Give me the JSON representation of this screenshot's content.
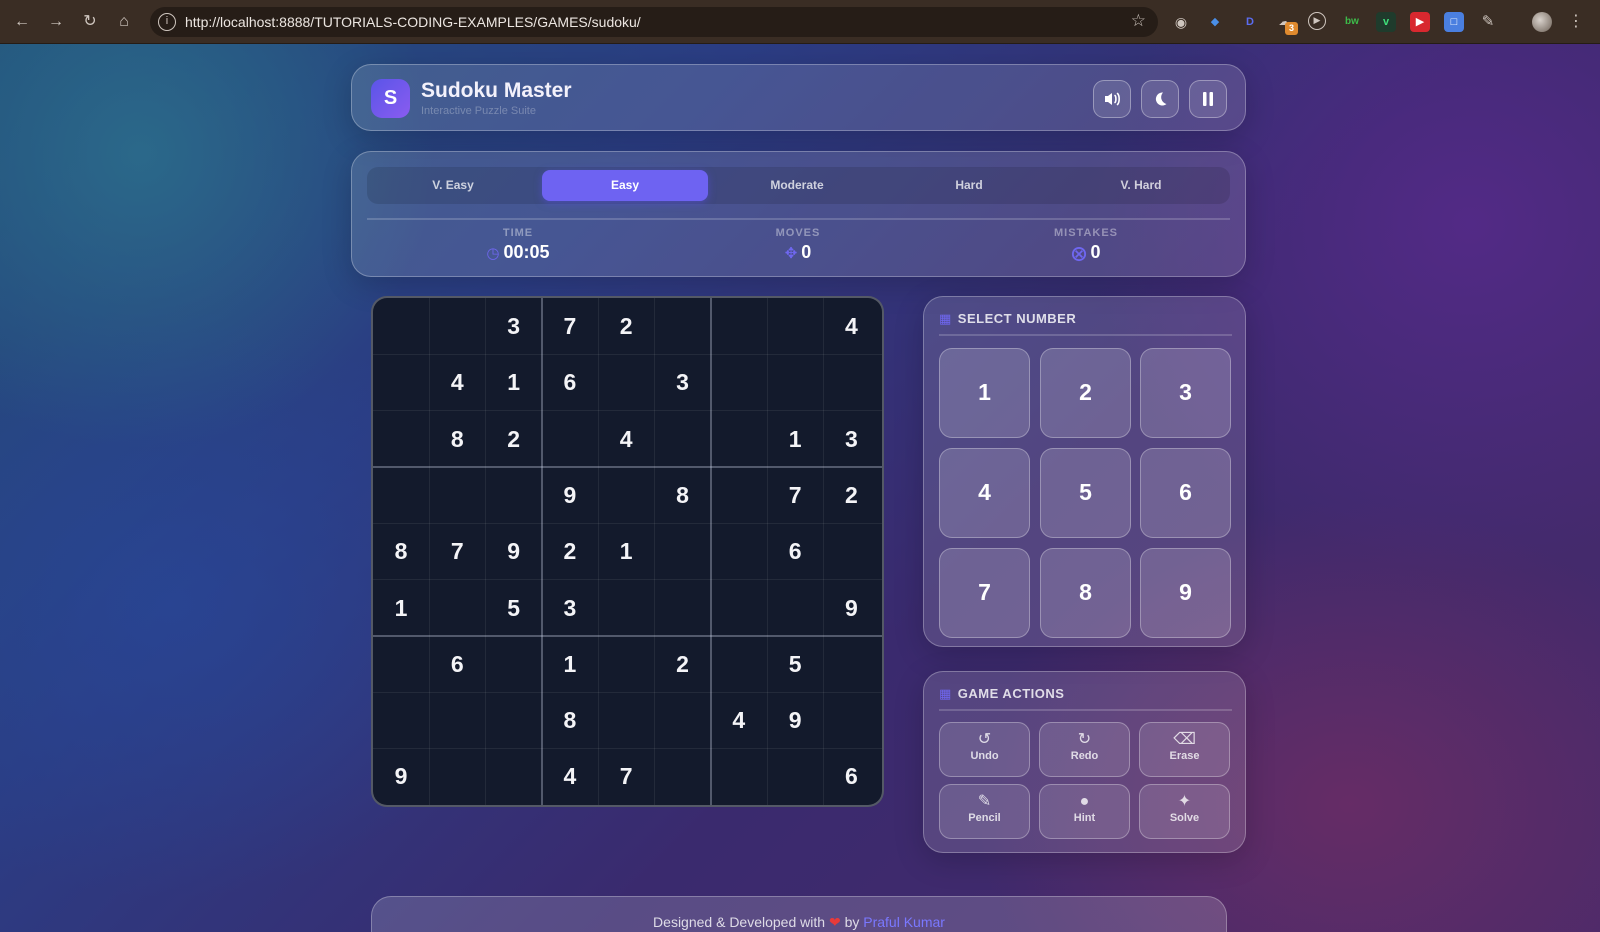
{
  "browser": {
    "url": "http://localhost:8888/TUTORIALS-CODING-EXAMPLES/GAMES/sudoku/",
    "extension_badge": "3"
  },
  "header": {
    "logo_letter": "S",
    "title": "Sudoku Master",
    "subtitle": "Interactive Puzzle Suite"
  },
  "difficulty": {
    "options": [
      "V. Easy",
      "Easy",
      "Moderate",
      "Hard",
      "V. Hard"
    ],
    "selected": "Easy"
  },
  "stats": {
    "time_label": "TIME",
    "time_value": "00:05",
    "moves_label": "MOVES",
    "moves_value": "0",
    "mistakes_label": "MISTAKES",
    "mistakes_value": "0"
  },
  "board": {
    "rows": [
      [
        "",
        "",
        "3",
        "7",
        "2",
        "",
        "",
        "",
        "4"
      ],
      [
        "",
        "4",
        "1",
        "6",
        "",
        "3",
        "",
        "",
        ""
      ],
      [
        "",
        "8",
        "2",
        "",
        "4",
        "",
        "",
        "1",
        "3"
      ],
      [
        "",
        "",
        "",
        "9",
        "",
        "8",
        "",
        "7",
        "2"
      ],
      [
        "8",
        "7",
        "9",
        "2",
        "1",
        "",
        "",
        "6",
        ""
      ],
      [
        "1",
        "",
        "5",
        "3",
        "",
        "",
        "",
        "",
        "9"
      ],
      [
        "",
        "6",
        "",
        "1",
        "",
        "2",
        "",
        "5",
        ""
      ],
      [
        "",
        "",
        "",
        "8",
        "",
        "",
        "4",
        "9",
        ""
      ],
      [
        "9",
        "",
        "",
        "4",
        "7",
        "",
        "",
        "",
        "6"
      ]
    ]
  },
  "number_pad": {
    "title": "SELECT NUMBER",
    "numbers": [
      "1",
      "2",
      "3",
      "4",
      "5",
      "6",
      "7",
      "8",
      "9"
    ]
  },
  "actions": {
    "title": "GAME ACTIONS",
    "buttons": [
      {
        "label": "Undo",
        "icon": "undo-icon"
      },
      {
        "label": "Redo",
        "icon": "redo-icon"
      },
      {
        "label": "Erase",
        "icon": "eraser-icon"
      },
      {
        "label": "Pencil",
        "icon": "pencil-icon"
      },
      {
        "label": "Hint",
        "icon": "lightbulb-icon"
      },
      {
        "label": "Solve",
        "icon": "magic-wand-icon"
      }
    ]
  },
  "footer": {
    "prefix": "Designed & Developed with",
    "middle": "by",
    "author": "Praful Kumar"
  },
  "colors": {
    "accent": "#6e63f2",
    "heart": "#e83a3a",
    "board_bg": "#131a2c"
  }
}
